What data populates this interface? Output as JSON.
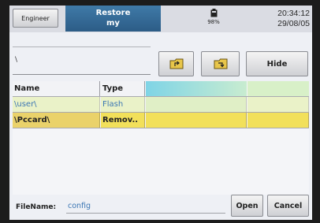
{
  "topbar": {
    "engineer_label": "Engineer",
    "title_line1": "Restore",
    "title_line2": "my",
    "battery": "98%",
    "time": "20:34:12",
    "date": "29/08/05"
  },
  "path": {
    "value": "\\"
  },
  "toolbar": {
    "up_icon": "folder-up-icon",
    "new_icon": "folder-new-icon",
    "hide_label": "Hide"
  },
  "table": {
    "columns": [
      "Name",
      "Type",
      "",
      ""
    ],
    "rows": [
      {
        "name": "\\user\\",
        "type": "Flash"
      },
      {
        "name": "\\Pccard\\",
        "type": "Remov.."
      }
    ]
  },
  "footer": {
    "filename_label": "FileName:",
    "filename_value": "config",
    "open_label": "Open",
    "cancel_label": "Cancel"
  },
  "colors": {
    "title_bg": "#2f6390",
    "selected_row": "#f2e05a",
    "link_text": "#3b76b4"
  }
}
